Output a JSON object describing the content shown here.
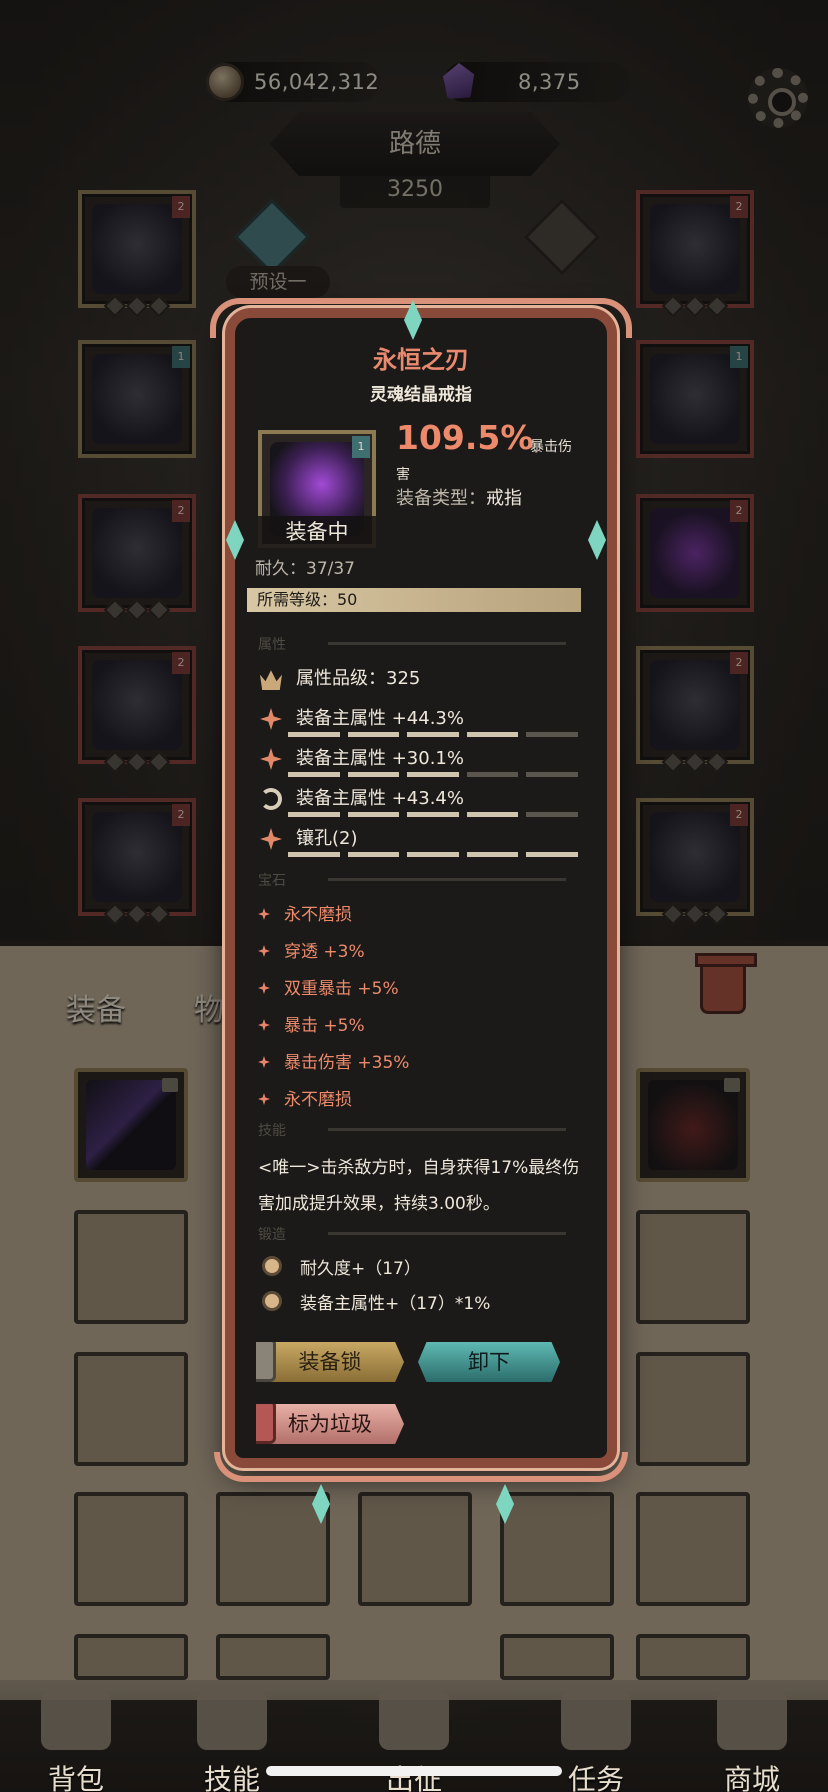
{
  "currency": {
    "coins": "56,042,312",
    "gems": "8,375"
  },
  "hero": {
    "name": "路德",
    "power": "3250",
    "preset": "预设一"
  },
  "tabs": {
    "equipment": "装备",
    "items_partial": "物"
  },
  "popup": {
    "title": "永恒之刃",
    "subtitle": "灵魂结晶戒指",
    "main_value": "109.5%",
    "main_label_a": "暴击伤",
    "main_label_b": "害",
    "equip_type_label": "装备类型：",
    "equip_type_value": "戒指",
    "equipped_badge": "装备中",
    "durability": "耐久：37/37",
    "required_level": "所需等级：50",
    "section_attr": "属性",
    "attr_quality": "属性品级：325",
    "attrs": [
      "装备主属性 +44.3%",
      "装备主属性 +30.1%",
      "装备主属性 +43.4%",
      "镶孔(2)"
    ],
    "section_gem": "宝石",
    "gems": [
      "永不磨损",
      "穿透 +3%",
      "双重暴击 +5%",
      "暴击 +5%",
      "暴击伤害 +35%",
      "永不磨损"
    ],
    "section_skill": "技能",
    "skill_text": "<唯一>击杀敌方时，自身获得17%最终伤害加成提升效果，持续3.00秒。",
    "section_forge": "锻造",
    "forge": [
      "耐久度+（17）",
      "装备主属性+（17）*1%"
    ],
    "btn_lock": "装备锁",
    "btn_unequip": "卸下",
    "btn_junk": "标为垃圾"
  },
  "nav": {
    "bag": "背包",
    "skills": "技能",
    "battle": "出征",
    "quests": "任务",
    "shop": "商城"
  }
}
